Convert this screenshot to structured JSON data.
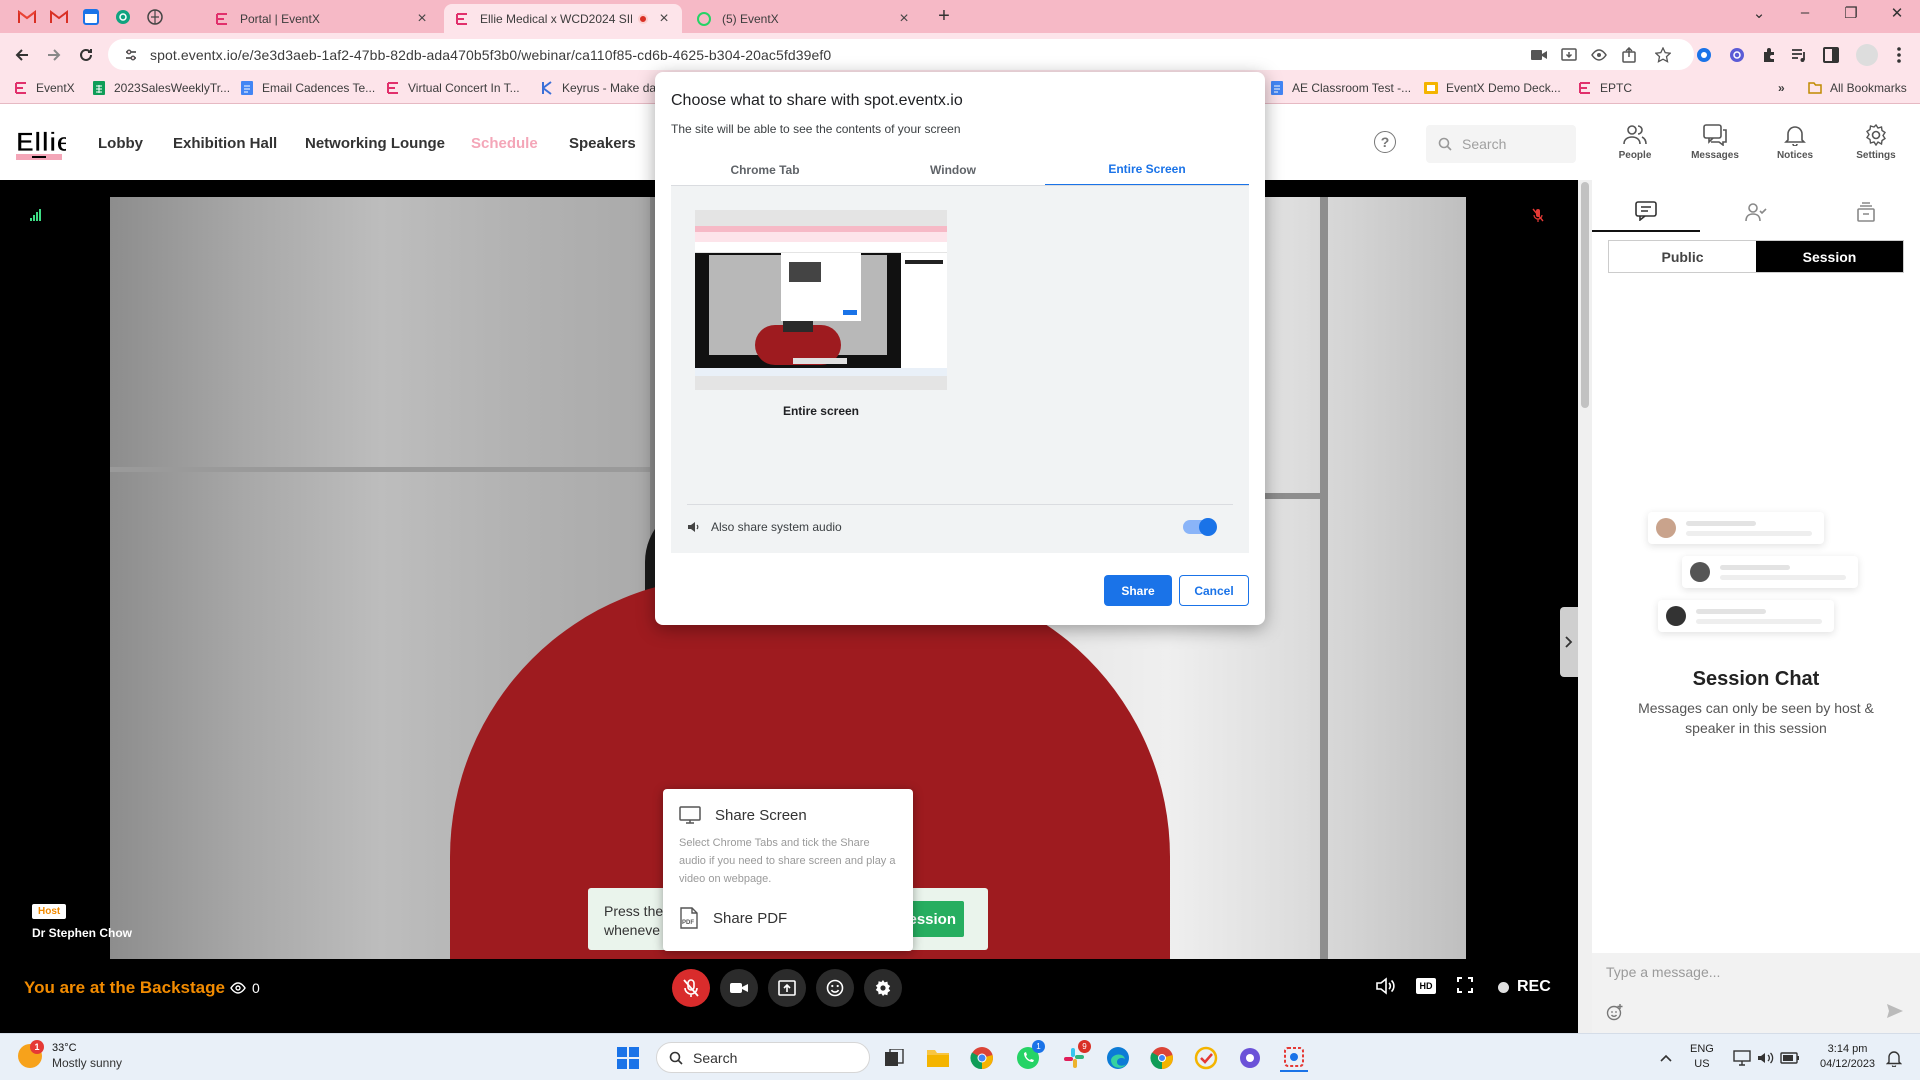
{
  "browser": {
    "tabs": [
      {
        "title": "Portal | EventX",
        "active": false
      },
      {
        "title": "Ellie Medical x WCD2024 SIN",
        "active": true
      },
      {
        "title": "(5) EventX",
        "active": false
      }
    ],
    "url": "spot.eventx.io/e/3e3d3aeb-1af2-47bb-82db-ada470b5f3b0/webinar/ca110f85-cd6b-4625-b304-20ac5fd39ef0",
    "bookmarks": [
      {
        "label": "EventX",
        "icon": "eventx-icon"
      },
      {
        "label": "2023SalesWeeklyTr...",
        "icon": "sheets-icon"
      },
      {
        "label": "Email Cadences Te...",
        "icon": "docs-icon"
      },
      {
        "label": "Virtual Concert In T...",
        "icon": "eventx-icon"
      },
      {
        "label": "Keyrus - Make dat",
        "icon": "keyrus-icon"
      },
      {
        "label": "AE Classroom Test -...",
        "icon": "docs-icon"
      },
      {
        "label": "EventX Demo Deck...",
        "icon": "slides-icon"
      },
      {
        "label": "EPTC",
        "icon": "eventx-icon"
      }
    ],
    "more_bookmarks": "»",
    "all_bookmarks": "All Bookmarks"
  },
  "app": {
    "logo": "Ellie",
    "nav": [
      {
        "label": "Lobby",
        "highlight": false
      },
      {
        "label": "Exhibition Hall",
        "highlight": false
      },
      {
        "label": "Networking Lounge",
        "highlight": false
      },
      {
        "label": "Schedule",
        "highlight": true
      },
      {
        "label": "Speakers",
        "highlight": false
      }
    ],
    "search_placeholder": "Search",
    "header_icons": [
      {
        "label": "People",
        "icon": "people-icon"
      },
      {
        "label": "Messages",
        "icon": "messages-icon"
      },
      {
        "label": "Notices",
        "icon": "bell-icon"
      },
      {
        "label": "Settings",
        "icon": "gear-icon"
      }
    ]
  },
  "stage": {
    "host_badge": "Host",
    "speaker_name": "Dr Stephen Chow",
    "backstage_text": "You are at the Backstage",
    "viewer_count": "0",
    "rec_label": "REC",
    "hd_label": "HD",
    "press_popup_text": "Press the",
    "press_popup_text2": "wheneve",
    "press_popup_button": "Session",
    "share_menu": {
      "share_screen": "Share Screen",
      "share_screen_desc": "Select Chrome Tabs and tick the Share audio if you need to share screen and play a video on webpage.",
      "share_pdf": "Share PDF"
    }
  },
  "chat": {
    "segments": [
      {
        "label": "Public",
        "active": false
      },
      {
        "label": "Session",
        "active": true
      }
    ],
    "title": "Session Chat",
    "subtitle": "Messages can only be seen by host & speaker in this session",
    "input_placeholder": "Type a message..."
  },
  "share_dialog": {
    "title": "Choose what to share with spot.eventx.io",
    "subtitle": "The site will be able to see the contents of your screen",
    "tabs": [
      {
        "label": "Chrome Tab",
        "active": false
      },
      {
        "label": "Window",
        "active": false
      },
      {
        "label": "Entire Screen",
        "active": true
      }
    ],
    "thumbnail_label": "Entire screen",
    "audio_label": "Also share system audio",
    "audio_enabled": true,
    "share_button": "Share",
    "cancel_button": "Cancel"
  },
  "taskbar": {
    "weather_temp": "33°C",
    "weather_desc": "Mostly sunny",
    "weather_badge": "1",
    "search_label": "Search",
    "lang_1": "ENG",
    "lang_2": "US",
    "time": "3:14 pm",
    "date": "04/12/2023",
    "badges": {
      "chrome": "",
      "whatsapp": "1",
      "slack": "9"
    }
  },
  "colors": {
    "tab_strip": "#f6b9c6",
    "toolbar": "#fde4ea",
    "brand_orange": "#f28b00",
    "nav_highlight": "#f4a6b8",
    "dialog_blue": "#1a73e8",
    "mic_muted_red": "#d92c2c",
    "cta_green": "#27ae60"
  }
}
